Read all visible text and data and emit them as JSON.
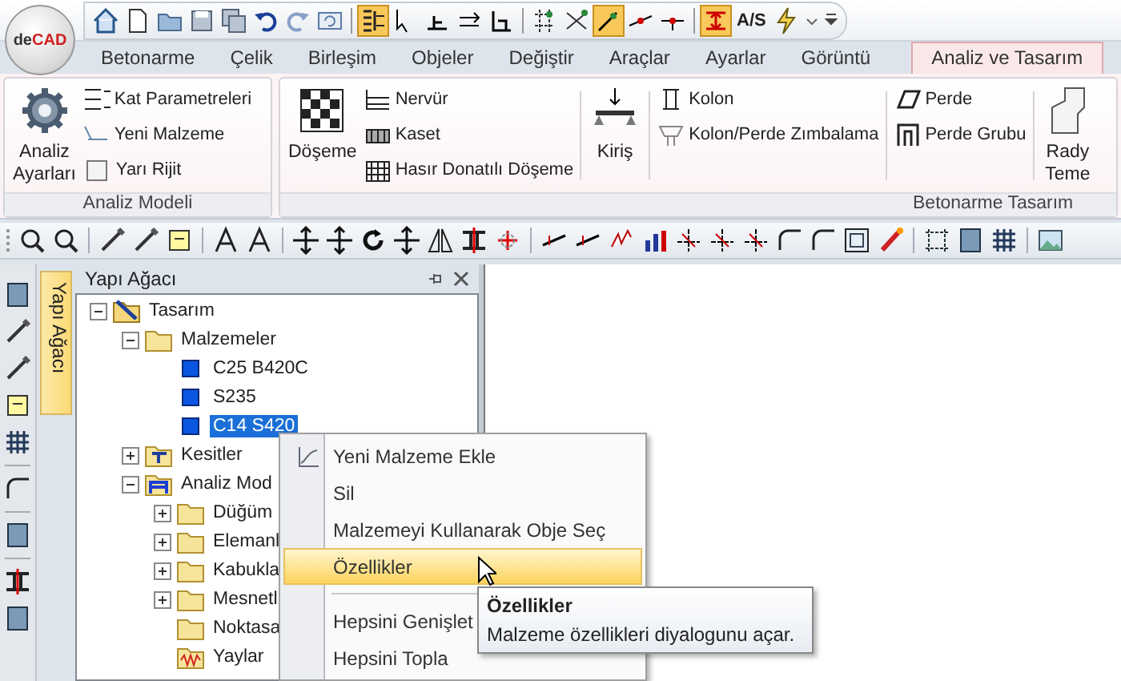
{
  "logo": [
    "de",
    "CAD"
  ],
  "quick_access_label": "A/S",
  "tabs": [
    {
      "label": "Betonarme",
      "selected": false
    },
    {
      "label": "Çelik",
      "selected": false
    },
    {
      "label": "Birleşim",
      "selected": false
    },
    {
      "label": "Objeler",
      "selected": false
    },
    {
      "label": "Değiştir",
      "selected": false
    },
    {
      "label": "Araçlar",
      "selected": false
    },
    {
      "label": "Ayarlar",
      "selected": false
    },
    {
      "label": "Görüntü",
      "selected": false
    },
    {
      "label": "Analiz ve Tasarım",
      "selected": true
    }
  ],
  "ribbon": {
    "groups": [
      {
        "label": "Analiz Modeli",
        "columns": [
          {
            "kind": "large",
            "lines": [
              "Analiz",
              "Ayarları"
            ]
          },
          {
            "kind": "small",
            "items": [
              {
                "kind": "button",
                "label": "Kat Parametreleri"
              },
              {
                "kind": "button",
                "label": "Yeni Malzeme"
              },
              {
                "kind": "checkbox",
                "label": "Yarı Rijit",
                "checked": false
              }
            ]
          }
        ]
      },
      {
        "label": "Betonarme Tasarım",
        "columns": [
          {
            "kind": "large",
            "lines": [
              "Döşeme"
            ]
          },
          {
            "kind": "small",
            "items": [
              {
                "kind": "button",
                "label": "Nervür"
              },
              {
                "kind": "button",
                "label": "Kaset"
              },
              {
                "kind": "button",
                "label": "Hasır Donatılı Döşeme"
              }
            ]
          },
          {
            "kind": "large",
            "lines": [
              "Kiriş"
            ]
          },
          {
            "kind": "small",
            "items": [
              {
                "kind": "button",
                "label": "Kolon"
              },
              {
                "kind": "button",
                "label": "Kolon/Perde Zımbalama"
              }
            ]
          },
          {
            "kind": "small",
            "items": [
              {
                "kind": "button",
                "label": "Perde"
              },
              {
                "kind": "button",
                "label": "Perde Grubu"
              }
            ]
          },
          {
            "kind": "large",
            "lines": [
              "Rady",
              "Teme"
            ]
          }
        ]
      }
    ]
  },
  "panel": {
    "title": "Yapı Ağacı",
    "side_tab": "Yapı Ağacı"
  },
  "tree": [
    {
      "label": "Tasarım",
      "kind": "root",
      "expanded": true,
      "selected": false,
      "children": [
        {
          "label": "Malzemeler",
          "kind": "folder",
          "expanded": true,
          "selected": false,
          "children": [
            {
              "label": "C25 B420C",
              "kind": "material",
              "selected": false
            },
            {
              "label": "S235",
              "kind": "material",
              "selected": false
            },
            {
              "label": "C14 S420",
              "kind": "material",
              "selected": true
            }
          ]
        },
        {
          "label": "Kesitler",
          "kind": "section",
          "expanded": false,
          "selected": false
        },
        {
          "label": "Analiz Mod",
          "kind": "frame",
          "expanded": true,
          "selected": false,
          "children": [
            {
              "label": "Düğüm",
              "kind": "folder",
              "expanded": false,
              "selected": false
            },
            {
              "label": "Elemanl",
              "kind": "folder",
              "expanded": false,
              "selected": false
            },
            {
              "label": "Kabukla",
              "kind": "folder",
              "expanded": false,
              "selected": false
            },
            {
              "label": "Mesnetl",
              "kind": "folder",
              "expanded": false,
              "selected": false
            },
            {
              "label": "Noktasa",
              "kind": "folder",
              "selected": false
            },
            {
              "label": "Yaylar",
              "kind": "spring",
              "selected": false
            }
          ]
        }
      ]
    }
  ],
  "context_menu": [
    {
      "kind": "item",
      "label": "Yeni Malzeme Ekle",
      "selected": false
    },
    {
      "kind": "item",
      "label": "Sil",
      "selected": false
    },
    {
      "kind": "item",
      "label": "Malzemeyi Kullanarak Obje Seç",
      "selected": false
    },
    {
      "kind": "item",
      "label": "Özellikler",
      "selected": true
    },
    {
      "kind": "separator"
    },
    {
      "kind": "item",
      "label": "Hepsini Genişlet",
      "selected": false
    },
    {
      "kind": "item",
      "label": "Hepsini Topla",
      "selected": false
    }
  ],
  "tooltip": {
    "title": "Özellikler",
    "text": "Malzeme özellikleri diyalogunu açar."
  }
}
